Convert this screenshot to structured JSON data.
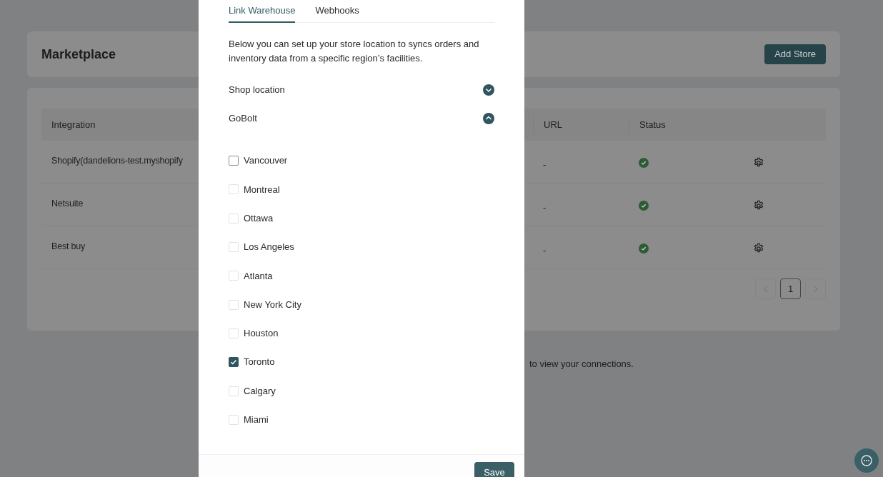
{
  "page": {
    "title": "Marketplace",
    "add_button": "Add Store",
    "table": {
      "columns": [
        "Integration",
        "URL",
        "Status"
      ],
      "rows": [
        {
          "integration": "Shopify(dandelions-test.myshopify",
          "url": "-",
          "connected": true
        },
        {
          "integration": "Netsuite",
          "url": "-",
          "connected": true
        },
        {
          "integration": "Best buy",
          "url": "-",
          "connected": true
        }
      ]
    },
    "pagination": {
      "pages": [
        {
          "label": "1",
          "selected": true
        }
      ]
    },
    "note": "to view your connections."
  },
  "modal": {
    "tabs": [
      {
        "label": "Link Warehouse",
        "selected": true
      },
      {
        "label": "Webhooks",
        "selected": false
      }
    ],
    "description": "Below you can set up your store location to syncs orders and inventory data from a specific region’s facilities.",
    "sections": [
      {
        "label": "Shop location",
        "expanded": false
      },
      {
        "label": "GoBolt",
        "expanded": true
      }
    ],
    "locations": [
      {
        "label": "Vancouver",
        "checked": false
      },
      {
        "label": "Montreal",
        "checked": false
      },
      {
        "label": "Ottawa",
        "checked": false
      },
      {
        "label": "Los Angeles",
        "checked": false
      },
      {
        "label": "Atlanta",
        "checked": false
      },
      {
        "label": "New York City",
        "checked": false
      },
      {
        "label": "Houston",
        "checked": false
      },
      {
        "label": "Toronto",
        "checked": true
      },
      {
        "label": "Calgary",
        "checked": false
      },
      {
        "label": "Miami",
        "checked": false
      }
    ],
    "save_button": "Save"
  }
}
